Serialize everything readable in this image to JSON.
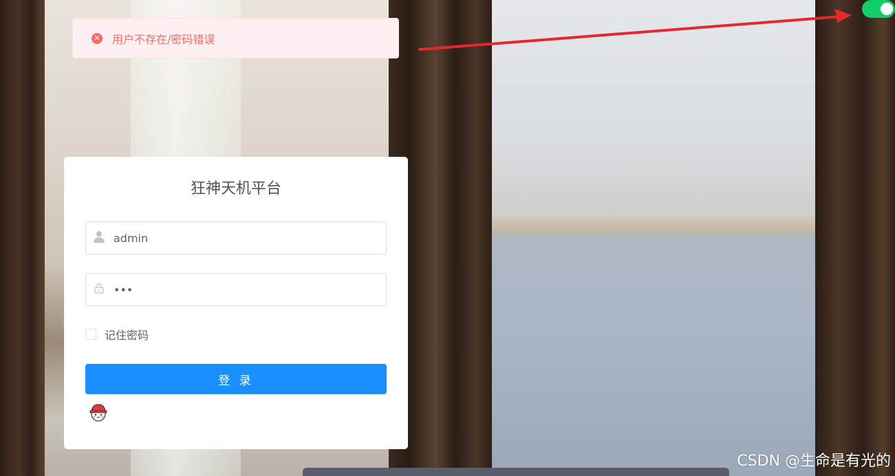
{
  "alert": {
    "message": "用户不存在/密码错误",
    "icon": "error-circle-icon",
    "color": "#f56c6c"
  },
  "theme_switch": {
    "state": "on",
    "color": "#13ce66"
  },
  "login": {
    "title": "狂神天机平台",
    "username_value": "admin",
    "password_value": "•••",
    "remember_label": "记住密码",
    "remember_checked": false,
    "submit_label": "登 录",
    "button_color": "#1890ff"
  },
  "watermark": "CSDN @生命是有光的"
}
